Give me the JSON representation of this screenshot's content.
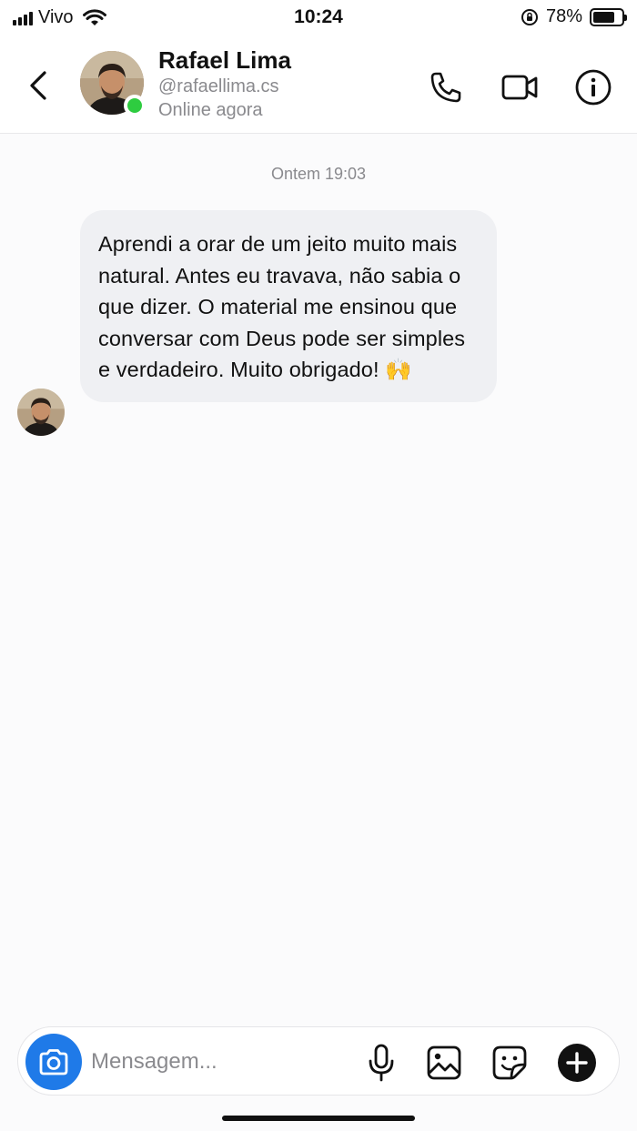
{
  "status_bar": {
    "carrier": "Vivo",
    "time": "10:24",
    "battery_percent": "78%",
    "battery_level": 0.78
  },
  "header": {
    "contact_name": "Rafael Lima",
    "contact_handle": "@rafaellima.cs",
    "contact_status": "Online agora",
    "online_color": "#2ecc40"
  },
  "chat": {
    "timestamp": "Ontem 19:03",
    "messages": [
      {
        "sender": "Rafael Lima",
        "text": "Aprendi a orar de um jeito muito mais natural. Antes eu travava, não sabia o que dizer. O material me ensinou que conversar com Deus pode ser simples e verdadeiro. Muito obrigado! 🙌"
      }
    ]
  },
  "composer": {
    "placeholder": "Mensagem...",
    "accent_color": "#1f7ae8"
  }
}
